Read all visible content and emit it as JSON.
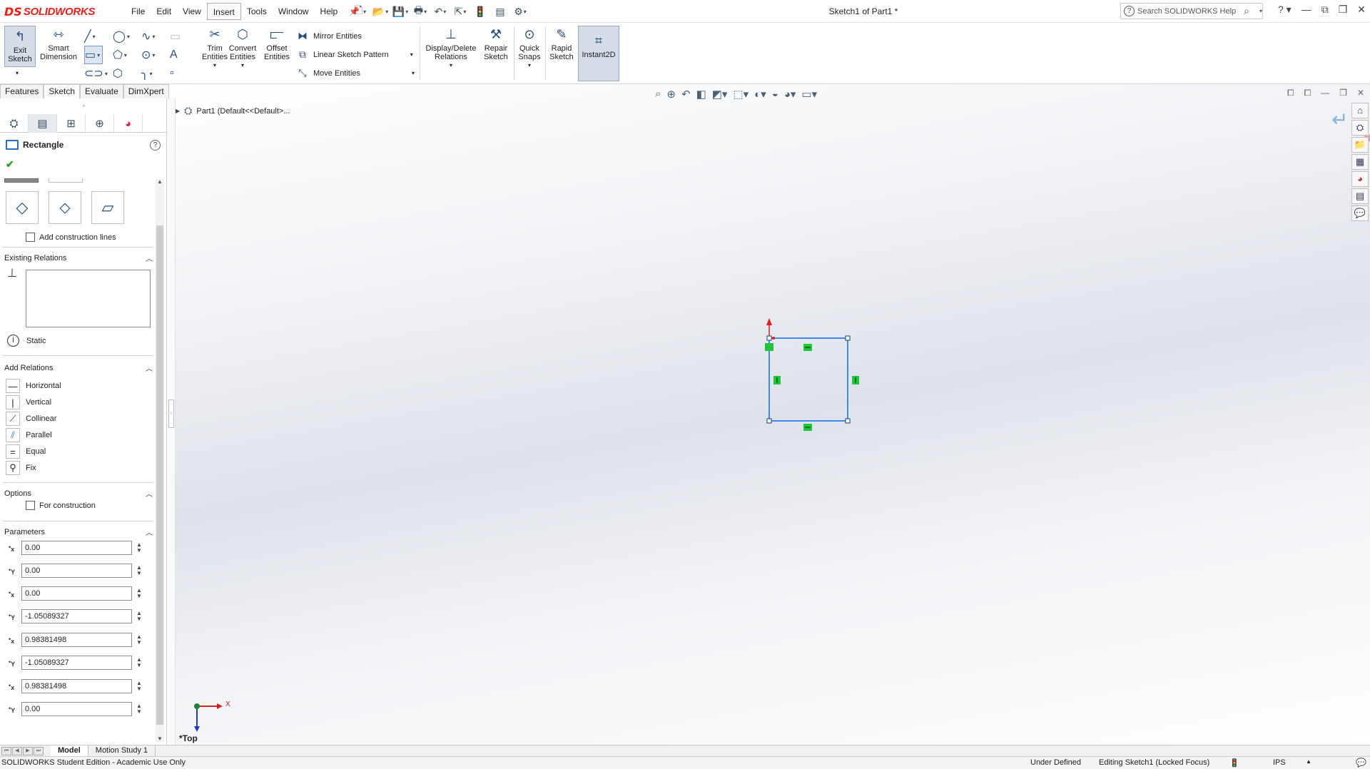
{
  "app": {
    "logo_ds": "DS",
    "logo_name": "SOLIDWORKS",
    "document_title": "Sketch1 of Part1 *"
  },
  "menu": [
    "File",
    "Edit",
    "View",
    "Insert",
    "Tools",
    "Window",
    "Help"
  ],
  "menu_active": "Insert",
  "help_search": {
    "placeholder": "Search SOLIDWORKS Help"
  },
  "command_manager": {
    "exit_sketch": [
      "Exit",
      "Sketch"
    ],
    "smart_dimension": [
      "Smart",
      "Dimension"
    ],
    "trim_entities": [
      "Trim",
      "Entities"
    ],
    "convert_entities": [
      "Convert",
      "Entities"
    ],
    "offset_entities": [
      "Offset",
      "Entities"
    ],
    "mirror_entities": "Mirror Entities",
    "linear_sketch_pattern": "Linear Sketch Pattern",
    "move_entities": "Move Entities",
    "display_delete_relations": [
      "Display/Delete",
      "Relations"
    ],
    "repair_sketch": [
      "Repair",
      "Sketch"
    ],
    "quick_snaps": [
      "Quick",
      "Snaps"
    ],
    "rapid_sketch": [
      "Rapid",
      "Sketch"
    ],
    "instant2d": "Instant2D"
  },
  "cm_tabs": [
    "Features",
    "Sketch",
    "Evaluate",
    "DimXpert"
  ],
  "cm_tab_active": "Sketch",
  "property_manager": {
    "title": "Rectangle",
    "add_construction_lines": "Add construction lines",
    "existing_relations": "Existing Relations",
    "status": "Static",
    "add_relations": "Add Relations",
    "relations": [
      "Horizontal",
      "Vertical",
      "Collinear",
      "Parallel",
      "Equal",
      "Fix"
    ],
    "options": "Options",
    "for_construction": "For construction",
    "parameters": "Parameters",
    "param_values": [
      "0.00",
      "0.00",
      "0.00",
      "-1.05089327",
      "0.98381498",
      "-1.05089327",
      "0.98381498",
      "0.00"
    ],
    "param_axes": [
      "x",
      "Y",
      "x",
      "Y",
      "x",
      "Y",
      "x",
      "Y"
    ]
  },
  "feature_tree": {
    "root": "Part1  (Default<<Default>..."
  },
  "view": {
    "name": "*Top",
    "triad_x": "X"
  },
  "bottom_tabs": [
    "Model",
    "Motion Study 1"
  ],
  "status": {
    "edition": "SOLIDWORKS Student Edition - Academic Use Only",
    "sketch_state": "Under Defined",
    "editing": "Editing Sketch1 (Locked Focus)",
    "units": "IPS"
  },
  "colors": {
    "sketch_line": "#3a8ee6",
    "relation_marker": "#22c43a",
    "origin_arrow": "#e02020",
    "accent_red": "#e2231a"
  }
}
